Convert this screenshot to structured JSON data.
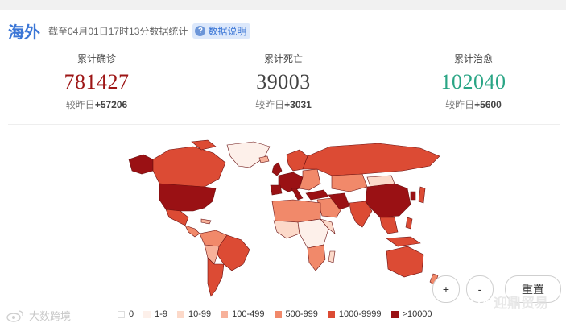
{
  "header": {
    "title": "海外",
    "subtitle": "截至04月01日17时13分数据统计",
    "info_label": "数据说明"
  },
  "stats": [
    {
      "label": "累计确诊",
      "value": "781427",
      "delta_prefix": "较昨日",
      "delta": "+57206",
      "color": "#9d1515"
    },
    {
      "label": "累计死亡",
      "value": "39003",
      "delta_prefix": "较昨日",
      "delta": "+3031",
      "color": "#444444"
    },
    {
      "label": "累计治愈",
      "value": "102040",
      "delta_prefix": "较昨日",
      "delta": "+5600",
      "color": "#2aa585"
    }
  ],
  "map_controls": {
    "zoom_in": "+",
    "zoom_out": "-",
    "reset": "重置"
  },
  "legend": [
    {
      "label": "0",
      "color": "#ffffff"
    },
    {
      "label": "1-9",
      "color": "#fdf0ea"
    },
    {
      "label": "10-99",
      "color": "#fcd9c9"
    },
    {
      "label": "100-499",
      "color": "#f7b19a"
    },
    {
      "label": "500-999",
      "color": "#f1896a"
    },
    {
      "label": "1000-9999",
      "color": "#dc4b34"
    },
    {
      "label": ">10000",
      "color": "#9a1114"
    }
  ],
  "watermarks": {
    "left": "大数跨境",
    "right": "迎鼎贸易"
  }
}
